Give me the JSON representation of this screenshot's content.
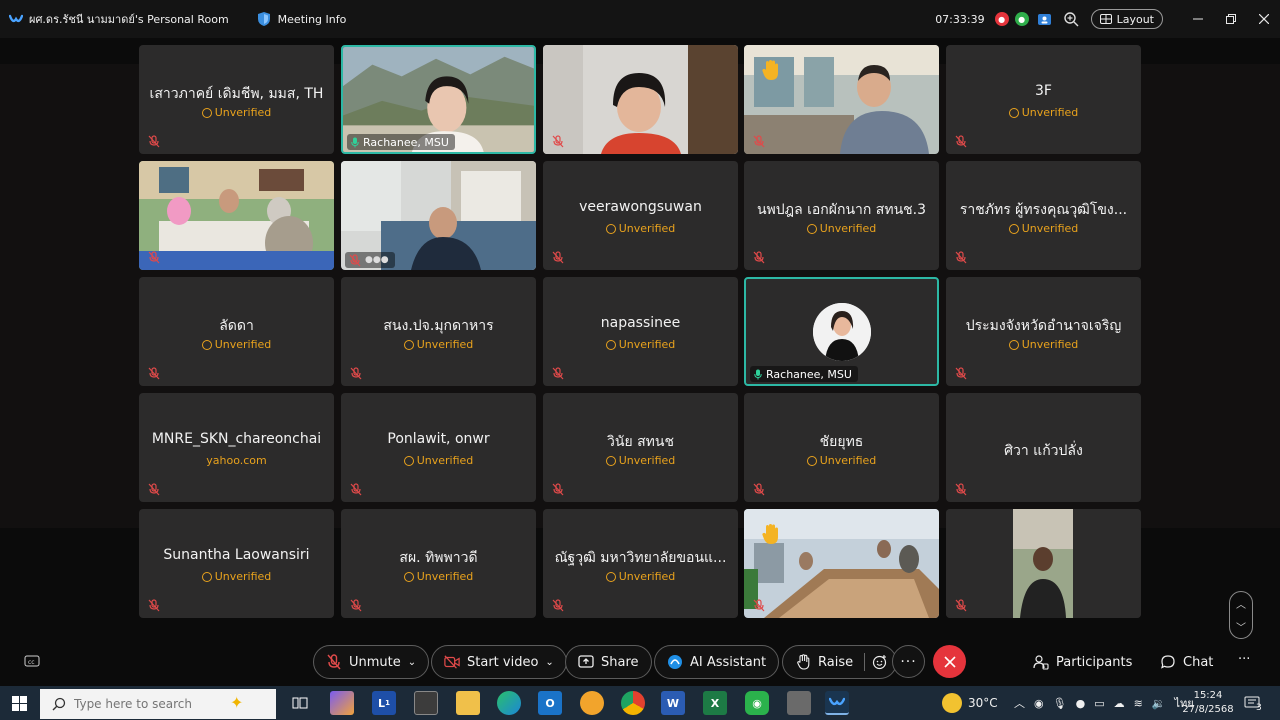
{
  "titlebar": {
    "room_title": "ผศ.ดร.รัชนี นามมาดย์'s Personal Room",
    "meeting_info": "Meeting Info",
    "time": "07:33:39",
    "layout_label": "Layout"
  },
  "tiles": [
    {
      "name": "เสาวภาคย์ เดิมชีพ, มมส, TH",
      "status": "Unverified"
    },
    {
      "label": "Rachanee, MSU"
    },
    {},
    {},
    {
      "name": "3F",
      "status": "Unverified"
    },
    {},
    {},
    {
      "name": "veerawongsuwan",
      "status": "Unverified"
    },
    {
      "name": "นพปฎล เอกผักนาก สทนช.3",
      "status": "Unverified"
    },
    {
      "name": "ราชภัทร ผู้ทรงคุณวุฒิโขง...",
      "status": "Unverified"
    },
    {
      "name": "ลัดดา",
      "status": "Unverified"
    },
    {
      "name": "สนง.ปจ.มุกดาหาร",
      "status": "Unverified"
    },
    {
      "name": "napassinee",
      "status": "Unverified"
    },
    {
      "label": "Rachanee, MSU"
    },
    {
      "name": "ประมงจังหวัดอำนาจเจริญ",
      "status": "Unverified"
    },
    {
      "name": "MNRE_SKN_chareonchai",
      "status": "yahoo.com"
    },
    {
      "name": "Ponlawit, onwr",
      "status": "Unverified"
    },
    {
      "name": "วินัย สทนช",
      "status": "Unverified"
    },
    {
      "name": "ชัยยุทธ",
      "status": "Unverified"
    },
    {
      "name": "ศิวา แก้วปลั่ง"
    },
    {
      "name": "Sunantha Laowansiri",
      "status": "Unverified"
    },
    {
      "name": "สผ. ทิพพาวดี",
      "status": "Unverified"
    },
    {
      "name": "ณัฐวุฒิ มหาวิทยาลัยขอนแ...",
      "status": "Unverified"
    },
    {},
    {}
  ],
  "controls": {
    "unmute": "Unmute",
    "start_video": "Start video",
    "share": "Share",
    "ai_assistant": "AI Assistant",
    "raise": "Raise",
    "participants": "Participants",
    "chat": "Chat"
  },
  "taskbar": {
    "search_placeholder": "Type here to search",
    "weather": "30°C",
    "language": "ไทย",
    "time": "15:24",
    "date": "27/8/2568",
    "notifications": "3",
    "lens_badge": "1"
  },
  "colors": {
    "accent_teal": "#2db8a5",
    "unverified_orange": "#e8a21d",
    "end_call_red": "#e5343c",
    "muted_red": "#e04a4a"
  }
}
